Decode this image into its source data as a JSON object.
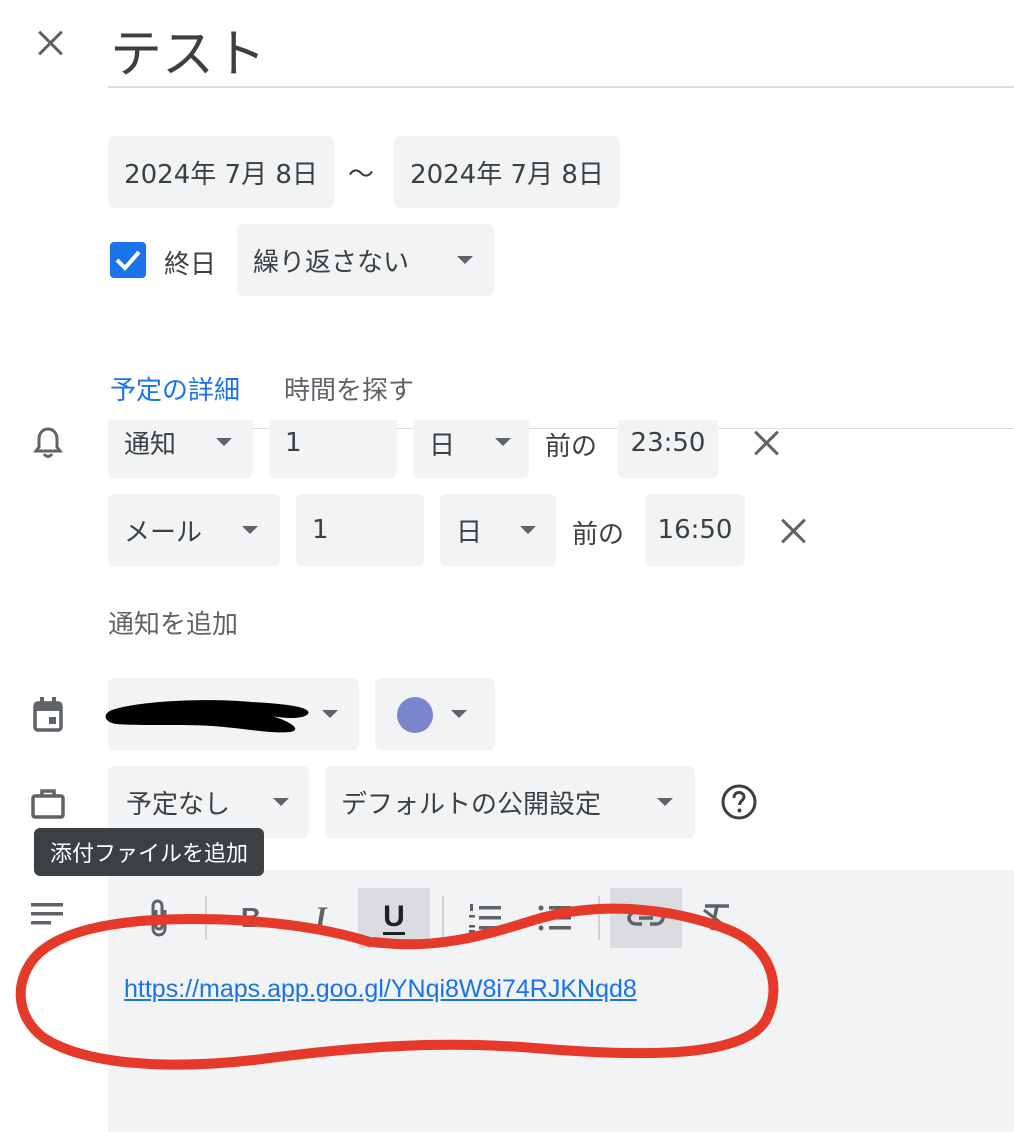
{
  "header": {
    "title": "テスト"
  },
  "dates": {
    "start": "2024年 7月 8日",
    "separator": "〜",
    "end": "2024年 7月 8日"
  },
  "allday": {
    "label": "終日",
    "checked": true
  },
  "recurrence": {
    "value": "繰り返さない"
  },
  "tabs": {
    "details": "予定の詳細",
    "find_time": "時間を探す"
  },
  "notifications": [
    {
      "type": "通知",
      "amount": "1",
      "unit": "日",
      "before": "前の",
      "time": "23:50"
    },
    {
      "type": "メール",
      "amount": "1",
      "unit": "日",
      "before": "前の",
      "time": "16:50"
    }
  ],
  "add_notification": "通知を追加",
  "calendar": {
    "color": "#7986cb"
  },
  "availability": {
    "value": "予定なし"
  },
  "visibility": {
    "value": "デフォルトの公開設定"
  },
  "tooltip": "添付ファイルを追加",
  "toolbar": {
    "bold": "B",
    "italic": "I",
    "underline": "U"
  },
  "description": {
    "link": "https://maps.app.goo.gl/YNqi8W8i74RJKNqd8"
  },
  "colors": {
    "accent": "#1a73e8",
    "annotation": "#e5392a",
    "field_bg": "#f1f3f4"
  }
}
